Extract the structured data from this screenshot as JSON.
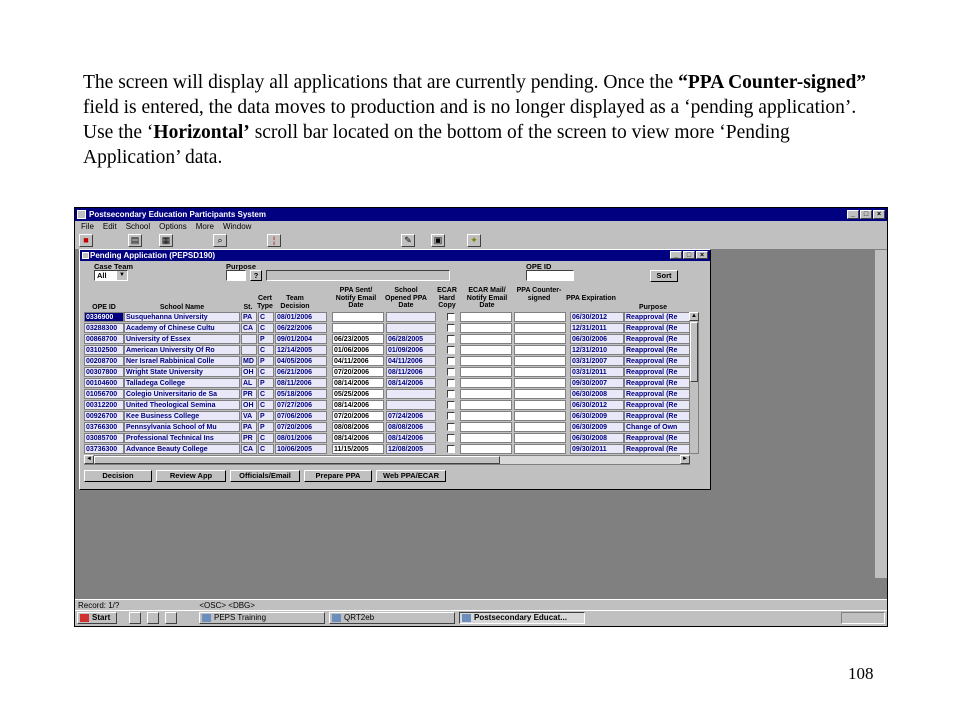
{
  "caption": {
    "p1": "The screen will display all applications that are currently pending. Once the ",
    "b1": "“PPA Counter-signed”",
    "p2": " field is entered, the data moves to production and is no longer displayed as a ‘pending application’. Use the ‘",
    "b2": "Horizontal’",
    "p3": " scroll bar located on the bottom of the screen to view more ‘Pending Application’ data."
  },
  "page_number": "108",
  "window": {
    "title": "Postsecondary Education Participants System",
    "menu": [
      "File",
      "Edit",
      "School",
      "Options",
      "More",
      "Window"
    ],
    "status": "Record: 1/?                                    <OSC> <DBG>"
  },
  "dialog": {
    "title": "Pending Application (PEPSD190)",
    "filters": {
      "case_team_label": "Case  Team",
      "case_team_value": "All",
      "purpose_label": "Purpose",
      "ope_id_label": "OPE ID",
      "sort_label": "Sort"
    },
    "columns": {
      "ope_id": "OPE ID",
      "school_name": "School Name",
      "st": "St.",
      "cert_type": "Cert Type",
      "team_decision": "Team Decision",
      "ppa_sent": "PPA Sent/ Notify Email Date",
      "school_opened": "School Opened PPA Date",
      "ecar_hard_copy": "ECAR Hard Copy",
      "ecar_mail": "ECAR Mail/ Notify Email Date",
      "ppa_counter": "PPA Counter- signed",
      "ppa_expiration": "PPA Expiration",
      "purpose": "Purpose"
    },
    "rows": [
      {
        "ope": "0336900",
        "name": "Susquehanna University",
        "st": "PA",
        "cert": "C",
        "team": "08/01/2006",
        "sent": "",
        "opened": "",
        "exp": "06/30/2012",
        "purpose": "Reapproval (Re"
      },
      {
        "ope": "03288300",
        "name": "Academy of Chinese Cultu",
        "st": "CA",
        "cert": "C",
        "team": "06/22/2006",
        "sent": "",
        "opened": "",
        "exp": "12/31/2011",
        "purpose": "Reapproval (Re"
      },
      {
        "ope": "00868700",
        "name": "University of Essex",
        "st": "",
        "cert": "P",
        "team": "09/01/2004",
        "sent": "06/23/2005",
        "opened": "06/28/2005",
        "exp": "06/30/2006",
        "purpose": "Reapproval (Re"
      },
      {
        "ope": "03102500",
        "name": "American University Of Ro",
        "st": "",
        "cert": "C",
        "team": "12/14/2005",
        "sent": "01/06/2006",
        "opened": "01/09/2006",
        "exp": "12/31/2010",
        "purpose": "Reapproval (Re"
      },
      {
        "ope": "00208700",
        "name": "Ner Israel Rabbinical Colle",
        "st": "MD",
        "cert": "P",
        "team": "04/05/2006",
        "sent": "04/11/2006",
        "opened": "04/11/2006",
        "exp": "03/31/2007",
        "purpose": "Reapproval (Re"
      },
      {
        "ope": "00307800",
        "name": "Wright State University",
        "st": "OH",
        "cert": "C",
        "team": "06/21/2006",
        "sent": "07/20/2006",
        "opened": "08/11/2006",
        "exp": "03/31/2011",
        "purpose": "Reapproval (Re"
      },
      {
        "ope": "00104600",
        "name": "Talladega College",
        "st": "AL",
        "cert": "P",
        "team": "08/11/2006",
        "sent": "08/14/2006",
        "opened": "08/14/2006",
        "exp": "09/30/2007",
        "purpose": "Reapproval (Re"
      },
      {
        "ope": "01056700",
        "name": "Colegio Universitario de Sa",
        "st": "PR",
        "cert": "C",
        "team": "05/18/2006",
        "sent": "05/25/2006",
        "opened": "",
        "exp": "06/30/2008",
        "purpose": "Reapproval (Re"
      },
      {
        "ope": "00312200",
        "name": "United Theological Semina",
        "st": "OH",
        "cert": "C",
        "team": "07/27/2006",
        "sent": "08/14/2006",
        "opened": "",
        "exp": "06/30/2012",
        "purpose": "Reapproval (Re"
      },
      {
        "ope": "00926700",
        "name": "Kee Business College",
        "st": "VA",
        "cert": "P",
        "team": "07/06/2006",
        "sent": "07/20/2006",
        "opened": "07/24/2006",
        "exp": "06/30/2009",
        "purpose": "Reapproval (Re"
      },
      {
        "ope": "03766300",
        "name": "Pennsylvania School of Mu",
        "st": "PA",
        "cert": "P",
        "team": "07/20/2006",
        "sent": "08/08/2006",
        "opened": "08/08/2006",
        "exp": "06/30/2009",
        "purpose": "Change of Own"
      },
      {
        "ope": "03085700",
        "name": "Professional Technical Ins",
        "st": "PR",
        "cert": "C",
        "team": "08/01/2006",
        "sent": "08/14/2006",
        "opened": "08/14/2006",
        "exp": "06/30/2008",
        "purpose": "Reapproval (Re"
      },
      {
        "ope": "03736300",
        "name": "Advance Beauty College",
        "st": "CA",
        "cert": "C",
        "team": "10/06/2005",
        "sent": "11/15/2005",
        "opened": "12/08/2005",
        "exp": "09/30/2011",
        "purpose": "Reapproval (Re"
      }
    ],
    "buttons": [
      "Decision",
      "Review App",
      "Officials/Email",
      "Prepare PPA",
      "Web PPA/ECAR"
    ]
  },
  "taskbar": {
    "start": "Start",
    "tasks": [
      "PEPS Training",
      "QRT2eb",
      "Postsecondary Educat..."
    ]
  },
  "colors": {
    "titlebar": "#000080",
    "chrome": "#c0c0c0",
    "desktop": "#808080"
  }
}
